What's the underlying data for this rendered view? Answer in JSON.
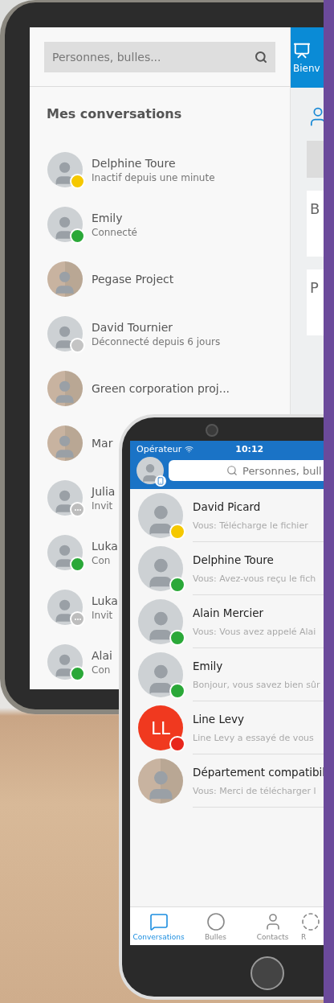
{
  "tablet": {
    "search": {
      "placeholder": "Personnes, bulles..."
    },
    "heading": "Mes conversations",
    "conversations": [
      {
        "name": "Delphine Toure",
        "status_text": "Inactif depuis une minute",
        "kind": "photo",
        "color": "#f5c800",
        "pending": false
      },
      {
        "name": "Emily",
        "status_text": "Connecté",
        "kind": "photo",
        "color": "#2aa838",
        "pending": false
      },
      {
        "name": "Pegase Project",
        "kind": "group"
      },
      {
        "name": "David Tournier",
        "status_text": "Déconnecté depuis 6 jours",
        "kind": "photo",
        "color": "#c4c4c4",
        "pending": false
      },
      {
        "name": "Green corporation proj...",
        "kind": "group"
      },
      {
        "name": "Mar",
        "kind": "group"
      },
      {
        "name": "Julia",
        "status_text": "Invit",
        "kind": "photo",
        "color": "#bdbdbd",
        "pending": true
      },
      {
        "name": "Luka",
        "status_text": "Con",
        "kind": "photo",
        "color": "#2aa838",
        "pending": false
      },
      {
        "name": "Luka",
        "status_text": "Invit",
        "kind": "photo",
        "color": "#bdbdbd",
        "pending": true
      },
      {
        "name": "Alai",
        "status_text": "Con",
        "kind": "photo",
        "color": "#2aa838",
        "pending": false
      }
    ],
    "side_tab": {
      "label": "Bienv",
      "selected": true
    },
    "side_letters": [
      "B",
      "P"
    ]
  },
  "phone": {
    "carrier": "Opérateur",
    "time": "10:12",
    "search": {
      "placeholder": "Personnes, bull"
    },
    "conversations": [
      {
        "name": "David Picard",
        "message": "Vous: Télécharge le fichier",
        "kind": "photo",
        "color": "#f5c800"
      },
      {
        "name": "Delphine Toure",
        "message": "Vous: Avez-vous reçu le fich",
        "kind": "photo",
        "color": "#2aa838"
      },
      {
        "name": "Alain Mercier",
        "message": "Vous: Vous avez appelé Alai",
        "kind": "photo",
        "color": "#2aa838"
      },
      {
        "name": "Emily",
        "message": "Bonjour, vous savez bien sûr",
        "kind": "photo",
        "color": "#2aa838"
      },
      {
        "name": "Line Levy",
        "message": "Line Levy a essayé de vous",
        "kind": "initials",
        "initials": "LL",
        "color": "#e8261c"
      },
      {
        "name": "Département compatibil",
        "message": "Vous: Merci de télécharger l",
        "kind": "group"
      }
    ],
    "tabs": [
      {
        "label": "Conversations",
        "kind": "chat",
        "selected": true
      },
      {
        "label": "Bulles",
        "kind": "bubble",
        "selected": false
      },
      {
        "label": "Contacts",
        "kind": "person",
        "selected": false
      },
      {
        "label": "R",
        "kind": "ring",
        "selected": false
      }
    ]
  }
}
